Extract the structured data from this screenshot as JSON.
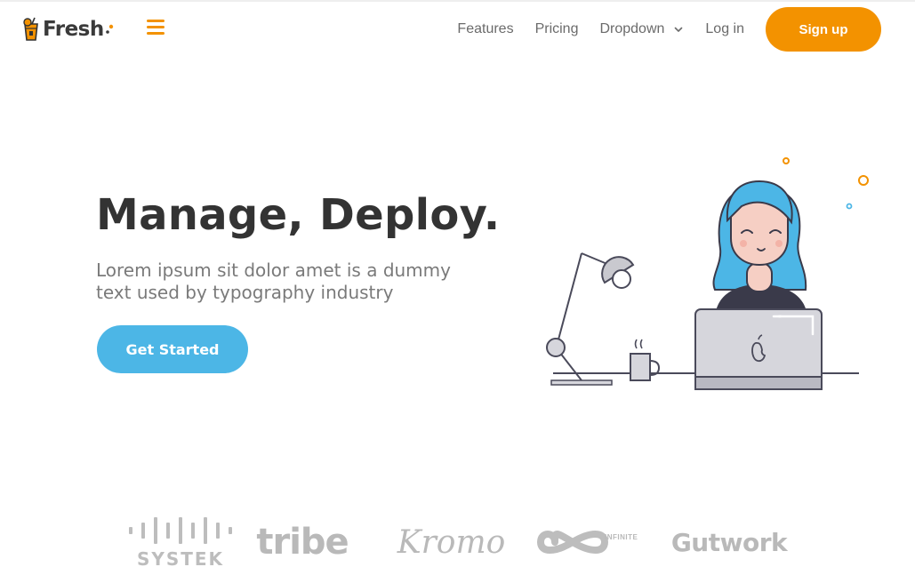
{
  "brand": {
    "name": "Fresh",
    "accent": "#f39200",
    "secondary": "#4cb6e6"
  },
  "nav": {
    "menu_icon": "hamburger-icon",
    "links": [
      "Features",
      "Pricing",
      "Dropdown",
      "Log in"
    ],
    "dropdown_icon": "chevron-down-icon",
    "signup_label": "Sign up"
  },
  "hero": {
    "title": "Manage, Deploy.",
    "subtitle": "Lorem ipsum sit dolor amet is a dummy text used by typography industry",
    "cta_label": "Get Started",
    "illustration": "woman-at-laptop-illustration"
  },
  "clients": [
    "SYSTEK",
    "tribe",
    "Kromo",
    "INFINITE",
    "Gutwork"
  ]
}
